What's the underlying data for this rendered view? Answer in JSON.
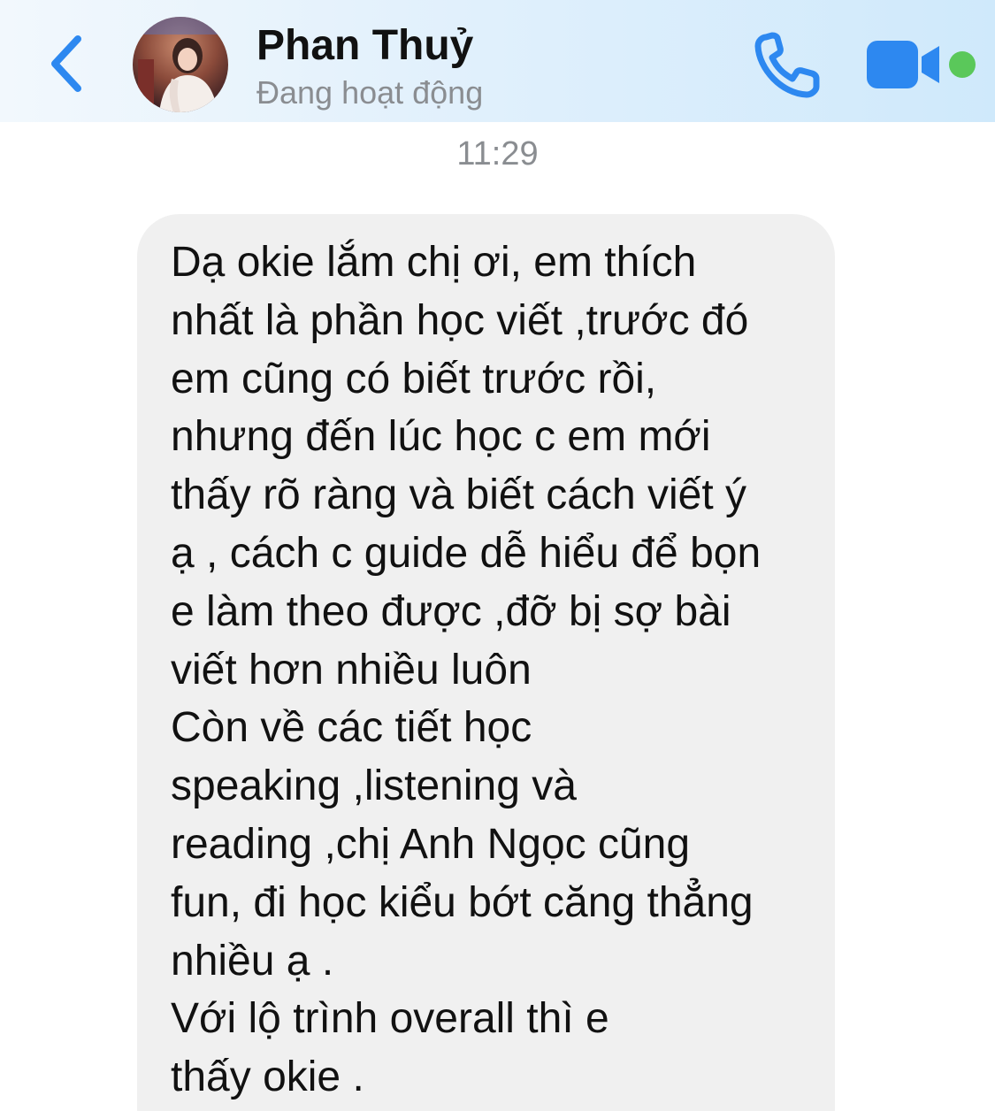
{
  "header": {
    "contact_name": "Phan Thuỷ",
    "status": "Đang hoạt động",
    "back_icon": "chevron-left-icon",
    "call_icon": "phone-icon",
    "video_icon": "video-camera-icon",
    "online_indicator_color": "#5ac85a",
    "accent_color": "#2d88f0"
  },
  "conversation": {
    "timestamp": "11:29",
    "messages": [
      {
        "lines": [
          "Dạ okie lắm chị ơi, em thích",
          "nhất là phần học viết ,trước đó",
          "em cũng có biết trước rồi,",
          "nhưng đến lúc học c em mới",
          "thấy rõ ràng và biết cách viết ý",
          "ạ , cách c guide dễ hiểu để bọn",
          "e làm theo được ,đỡ bị sợ bài",
          "viết hơn nhiều luôn",
          "Còn về các tiết học",
          "speaking ,listening và",
          "reading ,chị Anh Ngọc cũng",
          "fun, đi học kiểu bớt căng thẳng",
          "nhiều ạ .",
          "Với lộ trình overall thì e",
          "thấy okie ."
        ]
      }
    ]
  }
}
